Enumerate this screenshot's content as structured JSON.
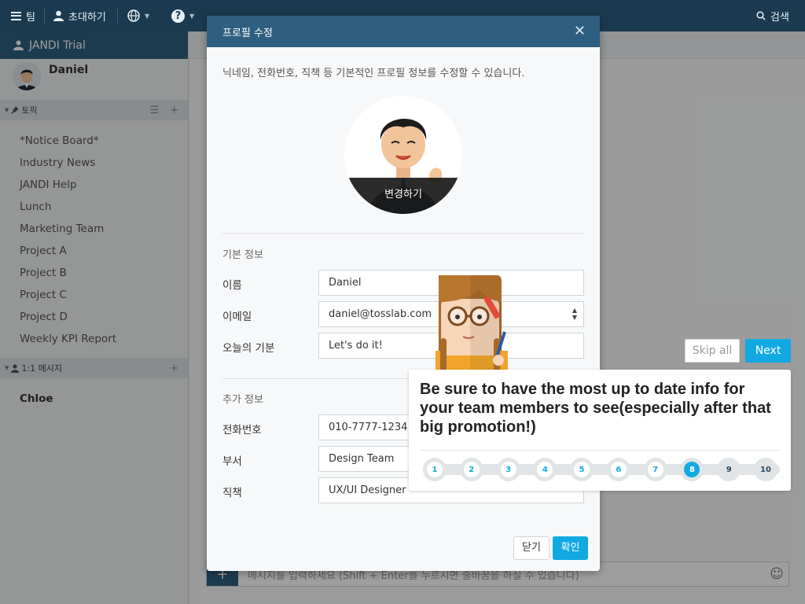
{
  "topbar": {
    "team_label": "팀",
    "invite_label": "초대하기",
    "search_label": "검색"
  },
  "sidebar": {
    "team_name": "JANDI Trial",
    "user_name": "Daniel",
    "topics_header": "토픽",
    "topics": [
      "*Notice Board*",
      "Industry News",
      "JANDI Help",
      "Lunch",
      "Marketing Team",
      "Project A",
      "Project B",
      "Project C",
      "Project D",
      "Weekly KPI Report"
    ],
    "dm_header": "1:1 메시지",
    "dms": [
      "Chloe"
    ]
  },
  "composer": {
    "placeholder": "메시지를 입력하세요 (Shift + Enter를 누르시면 줄바꿈을 하실 수 있습니다)"
  },
  "modal": {
    "title": "프로필 수정",
    "intro": "닉네임, 전화번호, 직책 등 기본적인 프로필 정보를 수정할 수 있습니다.",
    "change_photo": "변경하기",
    "basic_section": "기본 정보",
    "name_label": "이름",
    "name_value": "Daniel",
    "email_label": "이메일",
    "email_value": "daniel@tosslab.com",
    "mood_label": "오늘의 기분",
    "mood_value": "Let's do it!",
    "extra_section": "추가 정보",
    "phone_label": "전화번호",
    "phone_value": "010-7777-1234",
    "dept_label": "부서",
    "dept_value": "Design Team",
    "position_label": "직책",
    "position_value": "UX/UI Designer",
    "close_label": "닫기",
    "confirm_label": "확인"
  },
  "tutorial": {
    "skip_label": "Skip all",
    "next_label": "Next",
    "message": "Be sure to have the most up to date info for your team members to see(especially after that big promotion!)",
    "steps": [
      "1",
      "2",
      "3",
      "4",
      "5",
      "6",
      "7",
      "8",
      "9",
      "10"
    ],
    "current_step": 8
  },
  "colors": {
    "topbar": "#1b3a4f",
    "header_blue": "#2f5f80",
    "accent": "#12a9e3"
  }
}
